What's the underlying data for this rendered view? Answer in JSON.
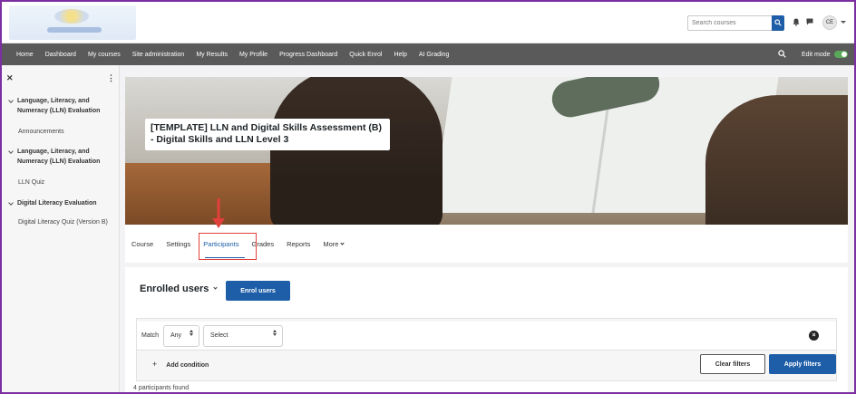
{
  "header": {
    "search_placeholder": "Search courses",
    "user_initials": "CE"
  },
  "nav": {
    "items": [
      "Home",
      "Dashboard",
      "My courses",
      "Site administration",
      "My Results",
      "My Profile",
      "Progress Dashboard",
      "Quick Enrol",
      "Help",
      "AI Grading"
    ],
    "edit_mode_label": "Edit mode",
    "edit_mode_on": true
  },
  "sidebar": {
    "sections": [
      {
        "title": "Language, Literacy, and Numeracy (LLN) Evaluation",
        "item": "Announcements"
      },
      {
        "title": "Language, Literacy, and Numeracy (LLN) Evaluation",
        "item": "LLN Quiz"
      },
      {
        "title": "Digital Literacy Evaluation",
        "item": "Digital Literacy Quiz (Version B)"
      }
    ]
  },
  "course": {
    "title": "[TEMPLATE] LLN and Digital Skills Assessment (B) - Digital Skills and LLN Level 3"
  },
  "tabs": {
    "course": "Course",
    "settings": "Settings",
    "participants": "Participants",
    "grades": "Grades",
    "reports": "Reports",
    "more": "More",
    "active": "Participants"
  },
  "participants": {
    "heading": "Enrolled users",
    "enrol_button": "Enrol users",
    "filter": {
      "match_label": "Match",
      "match_value": "Any",
      "condition_value": "Select",
      "add_condition": "Add condition",
      "clear_button": "Clear filters",
      "apply_button": "Apply filters"
    },
    "found_text": "4 participants found"
  },
  "colors": {
    "accent": "#1e5ea8",
    "navbar": "#5a5a5a",
    "highlight": "#e2403a",
    "frame": "#7b2fa0"
  }
}
